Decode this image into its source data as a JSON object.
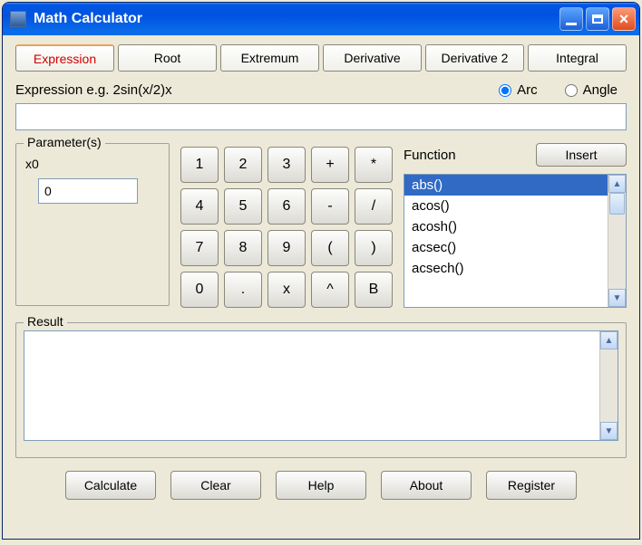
{
  "window": {
    "title": "Math Calculator"
  },
  "tabs": [
    "Expression",
    "Root",
    "Extremum",
    "Derivative",
    "Derivative 2",
    "Integral"
  ],
  "active_tab": 0,
  "expression": {
    "label": "Expression  e.g. 2sin(x/2)x",
    "value": "",
    "mode_arc": "Arc",
    "mode_angle": "Angle",
    "mode_selected": "arc"
  },
  "parameters": {
    "legend": "Parameter(s)",
    "name": "x0",
    "value": "0"
  },
  "keypad": [
    "1",
    "2",
    "3",
    "+",
    "*",
    "4",
    "5",
    "6",
    "-",
    "/",
    "7",
    "8",
    "9",
    "(",
    ")",
    "0",
    ".",
    "x",
    "^",
    "B"
  ],
  "function": {
    "label": "Function",
    "insert_label": "Insert",
    "items": [
      "abs()",
      "acos()",
      "acosh()",
      "acsec()",
      "acsech()"
    ],
    "selected": 0
  },
  "result": {
    "legend": "Result",
    "value": ""
  },
  "buttons": {
    "calculate": "Calculate",
    "clear": "Clear",
    "help": "Help",
    "about": "About",
    "register": "Register"
  }
}
